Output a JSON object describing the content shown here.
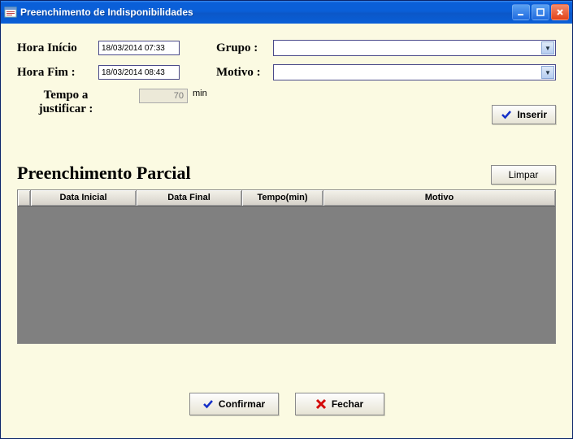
{
  "window": {
    "title": "Preenchimento de Indisponibilidades"
  },
  "form": {
    "hora_inicio_label": "Hora Início",
    "hora_inicio_value": "18/03/2014 07:33",
    "hora_fim_label": "Hora Fim :",
    "hora_fim_value": "18/03/2014 08:43",
    "grupo_label": "Grupo :",
    "grupo_value": "",
    "motivo_label": "Motivo :",
    "motivo_value": "",
    "tempo_label_line1": "Tempo a",
    "tempo_label_line2": "justificar :",
    "tempo_value": "70",
    "tempo_unit": "min"
  },
  "buttons": {
    "inserir": "Inserir",
    "limpar": "Limpar",
    "confirmar": "Confirmar",
    "fechar": "Fechar"
  },
  "section": {
    "heading": "Preenchimento Parcial"
  },
  "grid": {
    "columns": {
      "data_inicial": "Data Inicial",
      "data_final": "Data Final",
      "tempo_min": "Tempo(min)",
      "motivo": "Motivo"
    },
    "rows": []
  },
  "icons": {
    "check_color": "#1530c8",
    "x_color": "#d40808"
  }
}
